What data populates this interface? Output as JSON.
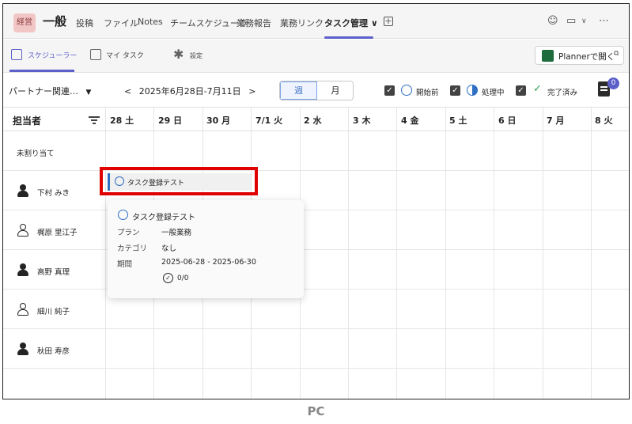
{
  "channel_bar": {
    "team_avatar": "経営",
    "channel_name": "一般",
    "tabs": [
      {
        "label": "投稿"
      },
      {
        "label": "ファイル"
      },
      {
        "label": "Notes"
      },
      {
        "label": "チームスケジューラ"
      },
      {
        "label": "業務報告"
      },
      {
        "label": "業務リンク"
      },
      {
        "label": "タスク管理 ∨",
        "active": true
      }
    ],
    "more": "⋯",
    "video_caret": "∨"
  },
  "planner_bar": {
    "tabs": [
      {
        "label": "スケジューラー",
        "icon": "calendar-icon",
        "active": true
      },
      {
        "label": "マイ タスク",
        "icon": "calendar-icon"
      },
      {
        "label": "設定",
        "icon": "gear-icon"
      }
    ],
    "open_in_planner": "Plannerで開く"
  },
  "filters": {
    "group": "パートナー関連…",
    "date_range": "2025年6月28日-7月11日",
    "view_week": "週",
    "view_month": "月",
    "status": [
      {
        "label": "開始前",
        "checked": true
      },
      {
        "label": "処理中",
        "checked": true
      },
      {
        "label": "完了済み",
        "checked": true
      }
    ],
    "badge_count": "0"
  },
  "grid": {
    "assignee_header": "担当者",
    "days": [
      "28 土",
      "29 日",
      "30 月",
      "7/1 火",
      "2 水",
      "3 木",
      "4 金",
      "5 土",
      "6 日",
      "7 月",
      "8 火"
    ],
    "unassigned": "未割り当て",
    "people": [
      "下村 みき",
      "梶原 里江子",
      "高野 真理",
      "細川 純子",
      "秋田 寿彦"
    ]
  },
  "task": {
    "title": "タスク登録テスト",
    "popup": {
      "title": "タスク登録テスト",
      "plan_key": "プラン",
      "plan_value": "一般業務",
      "category_key": "カテゴリ",
      "category_value": "なし",
      "period_key": "期間",
      "period_value": "2025-06-28 - 2025-06-30",
      "checklist": "0/0"
    }
  },
  "caption": "PC",
  "colors": {
    "accent": "#5b5fc7",
    "status_blue": "#2f6fc4",
    "highlight": "#e00000"
  }
}
